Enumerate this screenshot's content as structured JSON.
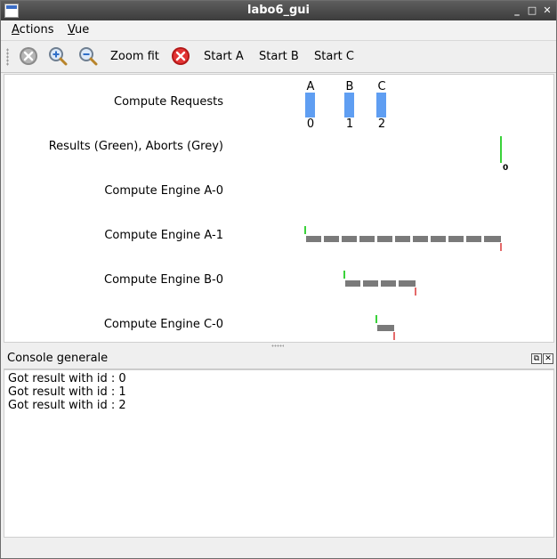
{
  "window": {
    "title": "labo6_gui",
    "controls": [
      "minimize-icon",
      "maximize-icon",
      "close-icon"
    ]
  },
  "menubar": {
    "actions": {
      "mnemonic": "A",
      "rest": "ctions"
    },
    "vue": {
      "mnemonic": "V",
      "rest": "ue"
    }
  },
  "toolbar": {
    "icons": [
      "stop-grey-icon",
      "zoom-in-icon",
      "zoom-out-icon",
      "stop-red-icon"
    ],
    "zoom_fit": "Zoom fit",
    "start_a": "Start A",
    "start_b": "Start B",
    "start_c": "Start C"
  },
  "timeline": {
    "rows": [
      "Compute Requests",
      "Results (Green), Aborts (Grey)",
      "Compute Engine A-0",
      "Compute Engine A-1",
      "Compute Engine B-0",
      "Compute Engine C-0"
    ],
    "requests": [
      {
        "letter": "A",
        "id": "0"
      },
      {
        "letter": "B",
        "id": "1"
      },
      {
        "letter": "C",
        "id": "2"
      }
    ],
    "result_label": "0",
    "colors": {
      "request": "#5f9ef2",
      "busy": "#7a7a7a",
      "start": "#3ad23a",
      "end": "#e46a6a"
    }
  },
  "console": {
    "title": "Console generale",
    "lines": [
      "Got result with id : 0",
      "Got result with id : 1",
      "Got result with id : 2"
    ]
  }
}
